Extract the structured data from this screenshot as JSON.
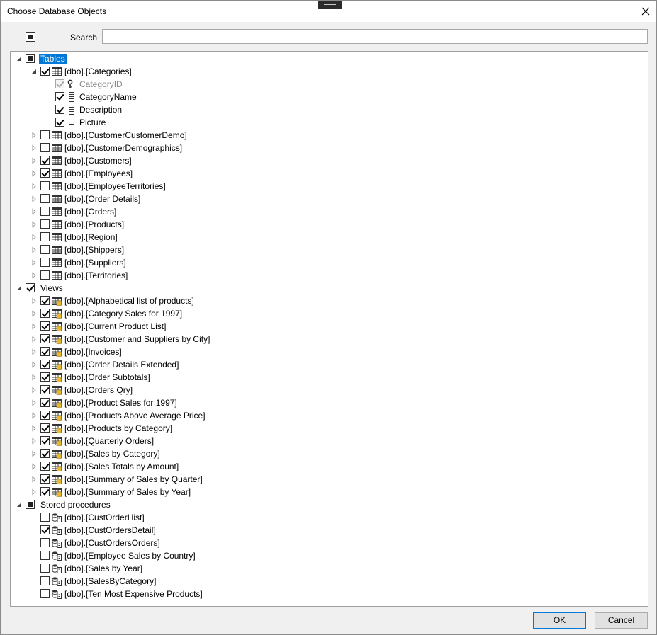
{
  "window": {
    "title": "Choose Database Objects"
  },
  "search": {
    "label": "Search",
    "value": ""
  },
  "tree": {
    "tables": {
      "label": "Tables",
      "state": "partial",
      "expanded": true
    },
    "categories": {
      "label": "[dbo].[Categories]",
      "state": "checked",
      "columns": [
        {
          "label": "CategoryID",
          "state": "checked",
          "key": true,
          "disabled": true
        },
        {
          "label": "CategoryName",
          "state": "checked",
          "key": false
        },
        {
          "label": "Description",
          "state": "checked",
          "key": false
        },
        {
          "label": "Picture",
          "state": "checked",
          "key": false
        }
      ]
    },
    "tables_items": [
      {
        "label": "[dbo].[CustomerCustomerDemo]",
        "state": "unchecked"
      },
      {
        "label": "[dbo].[CustomerDemographics]",
        "state": "unchecked"
      },
      {
        "label": "[dbo].[Customers]",
        "state": "checked"
      },
      {
        "label": "[dbo].[Employees]",
        "state": "checked"
      },
      {
        "label": "[dbo].[EmployeeTerritories]",
        "state": "unchecked"
      },
      {
        "label": "[dbo].[Order Details]",
        "state": "unchecked"
      },
      {
        "label": "[dbo].[Orders]",
        "state": "unchecked"
      },
      {
        "label": "[dbo].[Products]",
        "state": "unchecked"
      },
      {
        "label": "[dbo].[Region]",
        "state": "unchecked"
      },
      {
        "label": "[dbo].[Shippers]",
        "state": "unchecked"
      },
      {
        "label": "[dbo].[Suppliers]",
        "state": "unchecked"
      },
      {
        "label": "[dbo].[Territories]",
        "state": "unchecked"
      }
    ],
    "views": {
      "label": "Views",
      "state": "checked",
      "expanded": true
    },
    "views_items": [
      {
        "label": "[dbo].[Alphabetical list of products]",
        "state": "checked"
      },
      {
        "label": "[dbo].[Category Sales for 1997]",
        "state": "checked"
      },
      {
        "label": "[dbo].[Current Product List]",
        "state": "checked"
      },
      {
        "label": "[dbo].[Customer and Suppliers by City]",
        "state": "checked"
      },
      {
        "label": "[dbo].[Invoices]",
        "state": "checked"
      },
      {
        "label": "[dbo].[Order Details Extended]",
        "state": "checked"
      },
      {
        "label": "[dbo].[Order Subtotals]",
        "state": "checked"
      },
      {
        "label": "[dbo].[Orders Qry]",
        "state": "checked"
      },
      {
        "label": "[dbo].[Product Sales for 1997]",
        "state": "checked"
      },
      {
        "label": "[dbo].[Products Above Average Price]",
        "state": "checked"
      },
      {
        "label": "[dbo].[Products by Category]",
        "state": "checked"
      },
      {
        "label": "[dbo].[Quarterly Orders]",
        "state": "checked"
      },
      {
        "label": "[dbo].[Sales by Category]",
        "state": "checked"
      },
      {
        "label": "[dbo].[Sales Totals by Amount]",
        "state": "checked"
      },
      {
        "label": "[dbo].[Summary of Sales by Quarter]",
        "state": "checked"
      },
      {
        "label": "[dbo].[Summary of Sales by Year]",
        "state": "checked"
      }
    ],
    "procs": {
      "label": "Stored procedures",
      "state": "partial",
      "expanded": true
    },
    "procs_items": [
      {
        "label": "[dbo].[CustOrderHist]",
        "state": "unchecked"
      },
      {
        "label": "[dbo].[CustOrdersDetail]",
        "state": "checked"
      },
      {
        "label": "[dbo].[CustOrdersOrders]",
        "state": "unchecked"
      },
      {
        "label": "[dbo].[Employee Sales by Country]",
        "state": "unchecked"
      },
      {
        "label": "[dbo].[Sales by Year]",
        "state": "unchecked"
      },
      {
        "label": "[dbo].[SalesByCategory]",
        "state": "unchecked"
      },
      {
        "label": "[dbo].[Ten Most Expensive Products]",
        "state": "unchecked"
      }
    ]
  },
  "buttons": {
    "ok": "OK",
    "cancel": "Cancel"
  },
  "colors": {
    "selection": "#0078d7",
    "window_bg": "#f0f0f0"
  }
}
